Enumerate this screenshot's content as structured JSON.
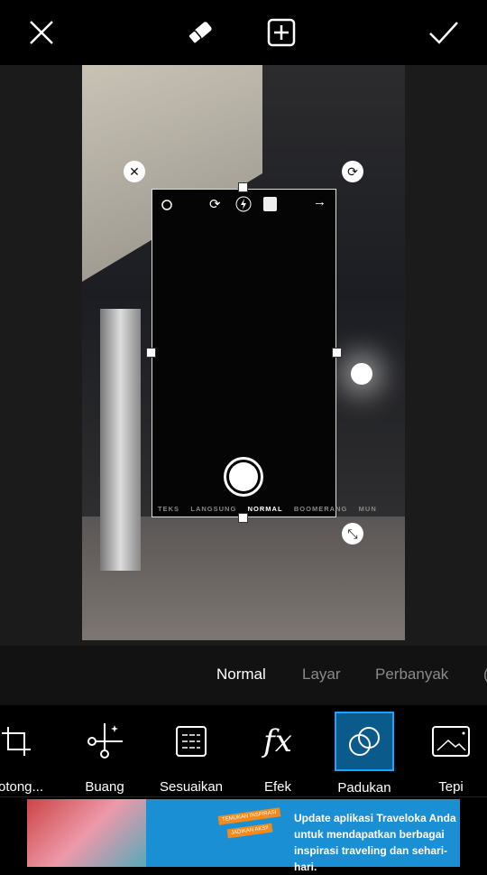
{
  "toolbar": {
    "close": "close-icon",
    "eraser": "eraser-icon",
    "add": "add-icon",
    "apply": "check-icon"
  },
  "sticker": {
    "modes": [
      "TEKS",
      "LANGSUNG",
      "NORMAL",
      "BOOMERANG",
      "MUN"
    ],
    "active_mode": "NORMAL"
  },
  "blend_modes": [
    "Normal",
    "Layar",
    "Perbanyak"
  ],
  "active_blend": "Normal",
  "tools": [
    {
      "label": "Potong..."
    },
    {
      "label": "Buang"
    },
    {
      "label": "Sesuaikan"
    },
    {
      "label": "Efek"
    },
    {
      "label": "Padukan"
    },
    {
      "label": "Tepi"
    }
  ],
  "active_tool": "Padukan",
  "accent": "#0b5a8c",
  "ad": {
    "text1": "Update aplikasi Traveloka Anda",
    "text2": "untuk mendapatkan berbagai",
    "text3": "inspirasi traveling dan sehari-hari.",
    "badge1": "TEMUKAN INSPIRASI",
    "badge2": "JADIKAN AKSI!"
  }
}
